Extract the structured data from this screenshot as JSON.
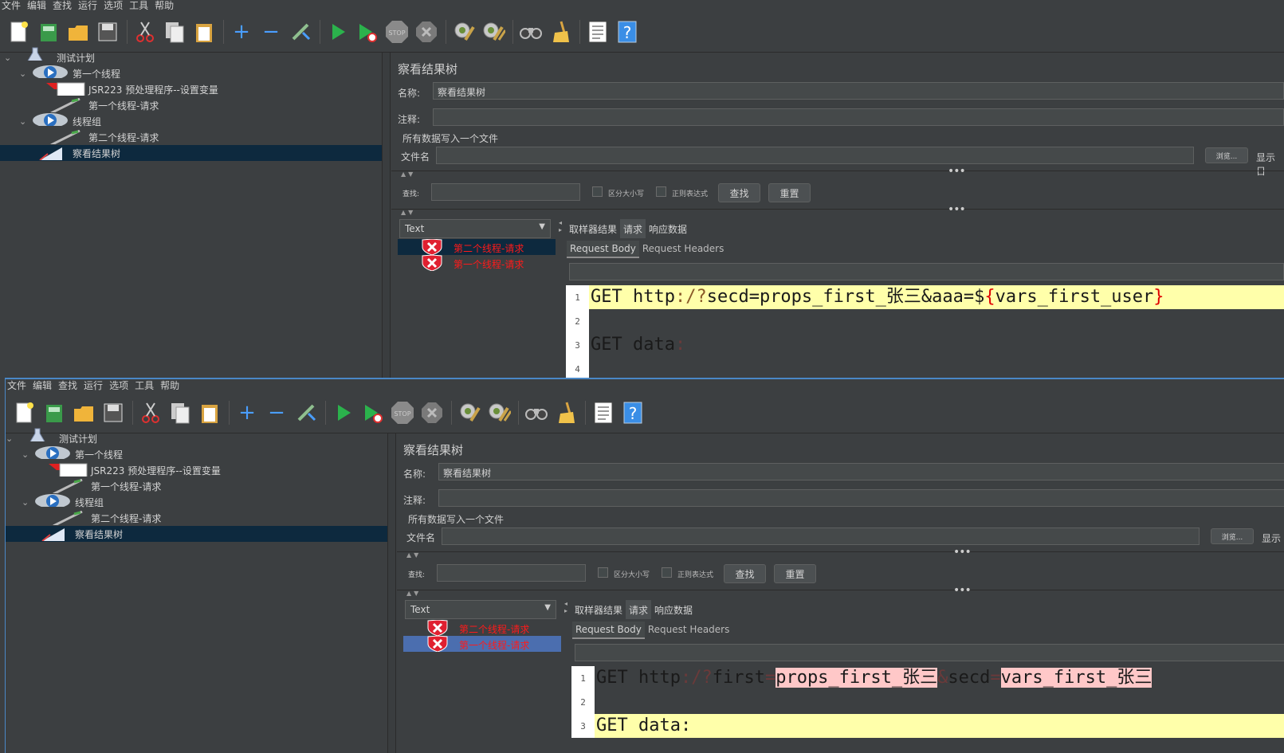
{
  "windows": [
    {
      "menu": [
        "文件",
        "编辑",
        "查找",
        "运行",
        "选项",
        "工具",
        "帮助"
      ],
      "tree": [
        {
          "label": "测试计划",
          "level": 0,
          "icon": "test-plan-icon",
          "expanded": true
        },
        {
          "label": "第一个线程",
          "level": 1,
          "icon": "thread-group-icon",
          "expanded": true
        },
        {
          "label": "JSR223 预处理程序--设置变量",
          "level": 2,
          "icon": "preprocessor-icon"
        },
        {
          "label": "第一个线程-请求",
          "level": 2,
          "icon": "sampler-icon"
        },
        {
          "label": "线程组",
          "level": 1,
          "icon": "thread-group-icon",
          "expanded": true
        },
        {
          "label": "第二个线程-请求",
          "level": 2,
          "icon": "sampler-icon"
        },
        {
          "label": "察看结果树",
          "level": 1,
          "icon": "listener-icon",
          "selected": true
        }
      ],
      "panel_title": "察看结果树",
      "name_label": "名称:",
      "name_value": "察看结果树",
      "comment_label": "注释:",
      "comment_value": "",
      "file_group_title": "所有数据写入一个文件",
      "file_label": "文件名",
      "browse_label": "浏览...",
      "show_label": "显示日",
      "search_label": "查找:",
      "case_label": "区分大小写",
      "regex_label": "正则表达式",
      "find_button": "查找",
      "reset_button": "重置",
      "renderer": "Text",
      "results": [
        {
          "label": "第二个线程-请求",
          "selected": true
        },
        {
          "label": "第一个线程-请求",
          "selected": false
        }
      ],
      "tabs": [
        "取样器结果",
        "请求",
        "响应数据"
      ],
      "active_tab": 1,
      "subtabs": [
        "Request Body",
        "Request Headers"
      ],
      "line_numbers": [
        "1",
        "2",
        "3",
        "4"
      ],
      "code_line1": {
        "a": "GET http",
        "b": ":/?",
        "c": "secd=props_first_张三&aaa=$",
        "d": "{",
        "e": "vars_first_user",
        "f": "}"
      },
      "code_line3": {
        "a": "GET data",
        "b": ":"
      }
    },
    {
      "menu": [
        "文件",
        "编辑",
        "查找",
        "运行",
        "选项",
        "工具",
        "帮助"
      ],
      "tree": [
        {
          "label": "测试计划",
          "level": 0,
          "icon": "test-plan-icon",
          "expanded": true
        },
        {
          "label": "第一个线程",
          "level": 1,
          "icon": "thread-group-icon",
          "expanded": true
        },
        {
          "label": "JSR223 预处理程序--设置变量",
          "level": 2,
          "icon": "preprocessor-icon"
        },
        {
          "label": "第一个线程-请求",
          "level": 2,
          "icon": "sampler-icon"
        },
        {
          "label": "线程组",
          "level": 1,
          "icon": "thread-group-icon",
          "expanded": true
        },
        {
          "label": "第二个线程-请求",
          "level": 2,
          "icon": "sampler-icon"
        },
        {
          "label": "察看结果树",
          "level": 1,
          "icon": "listener-icon",
          "selected": true
        }
      ],
      "panel_title": "察看结果树",
      "name_label": "名称:",
      "name_value": "察看结果树",
      "comment_label": "注释:",
      "comment_value": "",
      "file_group_title": "所有数据写入一个文件",
      "file_label": "文件名",
      "browse_label": "浏览...",
      "show_label": "显示",
      "search_label": "查找:",
      "case_label": "区分大小写",
      "regex_label": "正则表达式",
      "find_button": "查找",
      "reset_button": "重置",
      "renderer": "Text",
      "results": [
        {
          "label": "第二个线程-请求",
          "selected": false
        },
        {
          "label": "第一个线程-请求",
          "selected": true
        }
      ],
      "tabs": [
        "取样器结果",
        "请求",
        "响应数据"
      ],
      "active_tab": 1,
      "subtabs": [
        "Request Body",
        "Request Headers"
      ],
      "line_numbers": [
        "1",
        "2",
        "3"
      ],
      "code_line1": {
        "a": "GET http",
        "b": ":/?",
        "c": "first",
        "d": "=",
        "e": "props_first_张三",
        "f": "&",
        "g": "secd",
        "h": "=",
        "i": "vars_first_张三"
      },
      "code_line3": {
        "a": "GET data:"
      }
    }
  ],
  "toolbar_icons": [
    "new-icon",
    "templates-icon",
    "open-icon",
    "save-icon",
    "cut-icon",
    "copy-icon",
    "paste-icon",
    "expand-icon",
    "collapse-icon",
    "toggle-icon",
    "start-icon",
    "start-no-pause-icon",
    "stop-icon",
    "shutdown-icon",
    "clear-icon",
    "clear-all-icon",
    "search-icon",
    "reset-search-icon",
    "function-helper-icon",
    "help-icon"
  ]
}
